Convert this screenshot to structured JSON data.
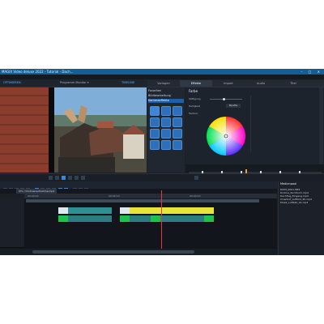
{
  "window": {
    "title": "MAGIX Video deluxe 2022 - Tutorial - Dach...",
    "controls": "–  □  ✕"
  },
  "menu": [
    "Datei",
    "Bearbeiten",
    "Effekte",
    "Ansicht",
    "Wiedergabe",
    "Hilfe"
  ],
  "toolbar": {
    "left_label": "OPTIMIEREN",
    "center_label": "Programm-Monitor ▾",
    "right_label": "TIMELINE"
  },
  "tabs": [
    "Vorlagen",
    "Effekte",
    "Import",
    "Audio",
    "Titel"
  ],
  "categories": {
    "items": [
      "Favoriten",
      "Bildbearbeitung",
      "Kameraeffekte"
    ],
    "selected": "Kameraeffekte"
  },
  "properties": {
    "title": "Farbe",
    "rows": [
      "Sättigung",
      "Helligkeit",
      "Farbton"
    ],
    "picker_button": "Pipette"
  },
  "timeline": {
    "tab_label": "VTL / Drohnenaufnahme.mp4",
    "ruler_markers": [
      "00:00:00",
      "00:00:10",
      "00:00:20"
    ]
  },
  "mediapool": {
    "title": "Medienpool",
    "items": [
      "DCIM_0001.MP4",
      "Drohne_Kirchturm.mp4",
      "Dachflug_Eingang.mp4",
      "Innenhof_Luftbild_4K.mp4",
      "Musik_Luftbild_01.mp3"
    ]
  },
  "colors": {
    "accent": "#1f5fa8",
    "titlebar": "#0f5f9a",
    "clip_teal": "#2f8f95",
    "clip_yellow": "#e9e43a",
    "clip_green": "#1ec24a",
    "playhead": "#e23a3a"
  }
}
